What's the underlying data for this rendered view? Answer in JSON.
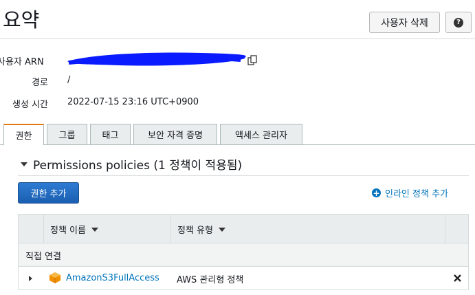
{
  "header": {
    "title": "요약",
    "delete_button": "사용자 삭제",
    "help_glyph": "?"
  },
  "summary": {
    "arn_label": "사용자 ARN",
    "path_label": "경로",
    "path_value": "/",
    "created_label": "생성 시간",
    "created_value": "2022-07-15 23:16 UTC+0900"
  },
  "tabs": [
    {
      "label": "권한",
      "active": true
    },
    {
      "label": "그룹",
      "active": false
    },
    {
      "label": "태그",
      "active": false
    },
    {
      "label": "보안 자격 증명",
      "active": false
    },
    {
      "label": "액세스 관리자",
      "active": false
    }
  ],
  "permissions": {
    "section_title": "Permissions policies (1 정책이 적용됨)",
    "add_button": "권한 추가",
    "inline_link": "인라인 정책 추가",
    "table": {
      "col_name": "정책 이름",
      "col_type": "정책 유형",
      "group_label": "직접 연결",
      "rows": [
        {
          "name": "AmazonS3FullAccess",
          "type": "AWS 관리형 정책"
        }
      ]
    }
  },
  "colors": {
    "accent_tab": "#e47911",
    "link": "#0073bb",
    "primary_button": "#1a5fb0",
    "redaction": "#0a1cff"
  },
  "icons": [
    "copy-icon",
    "help-icon",
    "plus-circle-icon",
    "caret-down-icon",
    "caret-right-icon",
    "policy-cube-icon",
    "remove-icon"
  ]
}
